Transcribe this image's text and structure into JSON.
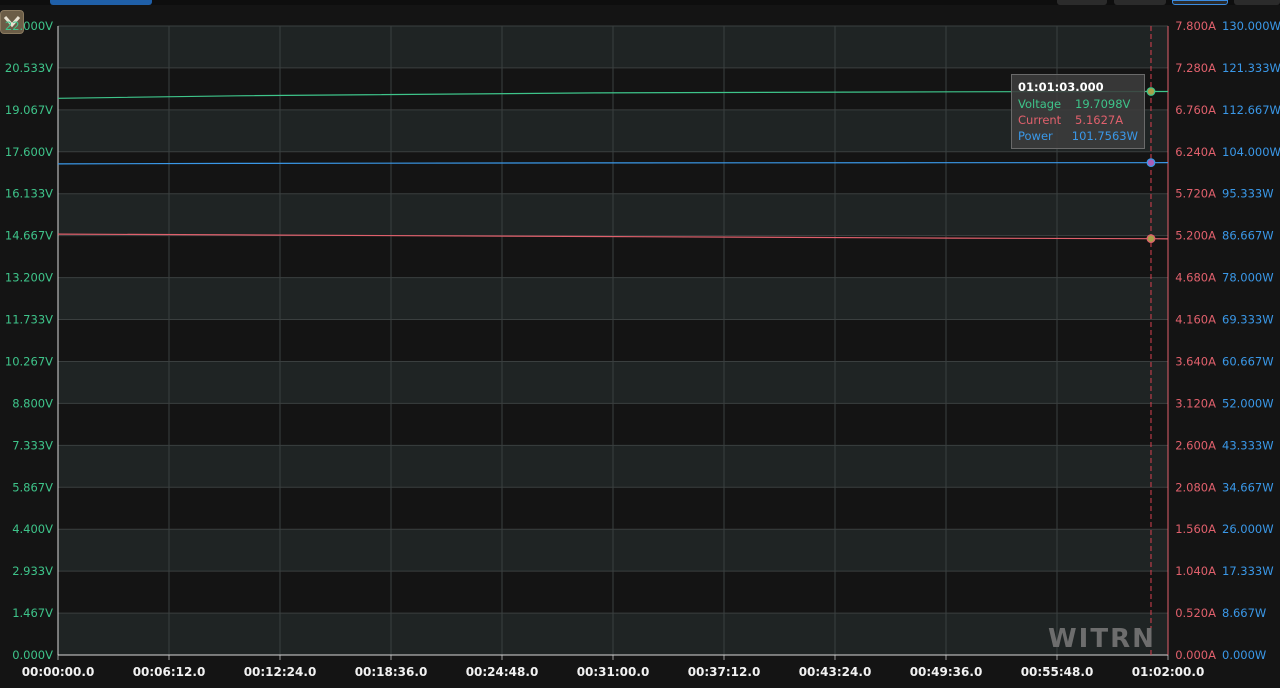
{
  "toolbar": {
    "collapse_icon": "chevron-down-icon"
  },
  "colors": {
    "voltage": "#3ec48a",
    "current": "#e0606c",
    "power": "#3a98e8",
    "cursor": "#d94050",
    "grid": "#3a3f3f",
    "band": "#1f2424"
  },
  "tooltip": {
    "time": "01:01:03.000",
    "voltage_label": "Voltage",
    "voltage_value": "19.7098V",
    "current_label": "Current",
    "current_value": "5.1627A",
    "power_label": "Power",
    "power_value": "101.7563W"
  },
  "watermark": "WITRN",
  "chart_data": {
    "type": "line",
    "x_ticks": [
      "00:00:00.0",
      "00:06:12.0",
      "00:12:24.0",
      "00:18:36.0",
      "00:24:48.0",
      "00:31:00.0",
      "00:37:12.0",
      "00:43:24.0",
      "00:49:36.0",
      "00:55:48.0",
      "01:02:00.0"
    ],
    "xlim_seconds": [
      0,
      3720
    ],
    "cursor_time_seconds": 3663,
    "y_left_ticks": [
      "0.000V",
      "1.467V",
      "2.933V",
      "4.400V",
      "5.867V",
      "7.333V",
      "8.800V",
      "10.267V",
      "11.733V",
      "13.200V",
      "14.667V",
      "16.133V",
      "17.600V",
      "19.067V",
      "20.533V",
      "22.000V"
    ],
    "y_current_ticks": [
      "0.000A",
      "0.520A",
      "1.040A",
      "1.560A",
      "2.080A",
      "2.600A",
      "3.120A",
      "3.640A",
      "4.160A",
      "4.680A",
      "5.200A",
      "5.720A",
      "6.240A",
      "6.760A",
      "7.280A",
      "7.800A"
    ],
    "y_power_ticks": [
      "0.000W",
      "8.667W",
      "17.333W",
      "26.000W",
      "34.667W",
      "43.333W",
      "52.000W",
      "60.667W",
      "69.333W",
      "78.000W",
      "86.667W",
      "95.333W",
      "104.000W",
      "112.667W",
      "121.333W",
      "130.000W"
    ],
    "ylim_voltage": [
      0,
      22
    ],
    "ylim_current": [
      0,
      7.8
    ],
    "ylim_power": [
      0,
      130
    ],
    "grid": true,
    "series": [
      {
        "name": "Voltage",
        "axis": "voltage",
        "x": [
          0,
          600,
          1800,
          3000,
          3663,
          3720
        ],
        "values": [
          19.47,
          19.56,
          19.66,
          19.7,
          19.71,
          19.71
        ]
      },
      {
        "name": "Current",
        "axis": "current",
        "x": [
          0,
          600,
          1800,
          3000,
          3663,
          3720
        ],
        "values": [
          5.22,
          5.21,
          5.19,
          5.17,
          5.163,
          5.16
        ]
      },
      {
        "name": "Power",
        "axis": "power",
        "x": [
          0,
          600,
          1800,
          3000,
          3663,
          3720
        ],
        "values": [
          101.5,
          101.6,
          101.7,
          101.75,
          101.756,
          101.76
        ]
      }
    ]
  }
}
